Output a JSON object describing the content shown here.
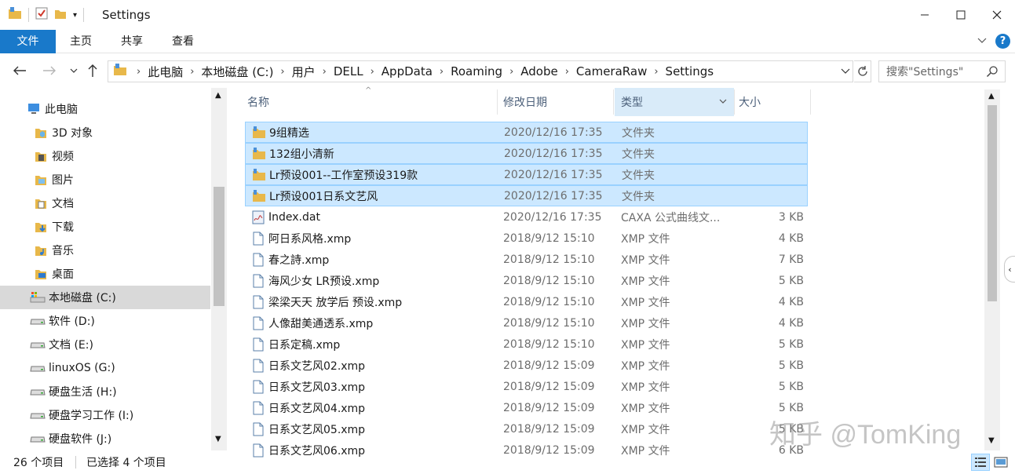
{
  "window": {
    "title": "Settings",
    "controls": {
      "minimize": "minimize-icon",
      "maximize": "maximize-icon",
      "close": "close-icon"
    }
  },
  "ribbon": {
    "tabs": [
      "文件",
      "主页",
      "共享",
      "查看"
    ],
    "accent": "#1979ca",
    "help": "?"
  },
  "address": {
    "breadcrumbs": [
      "此电脑",
      "本地磁盘 (C:)",
      "用户",
      "DELL",
      "AppData",
      "Roaming",
      "Adobe",
      "CameraRaw",
      "Settings"
    ],
    "search_placeholder": "搜索\"Settings\""
  },
  "nav": {
    "items": [
      {
        "label": "此电脑",
        "icon": "computer-icon"
      },
      {
        "label": "3D 对象",
        "icon": "3d-objects-folder-icon"
      },
      {
        "label": "视频",
        "icon": "videos-folder-icon"
      },
      {
        "label": "图片",
        "icon": "pictures-folder-icon"
      },
      {
        "label": "文档",
        "icon": "documents-folder-icon"
      },
      {
        "label": "下载",
        "icon": "downloads-folder-icon"
      },
      {
        "label": "音乐",
        "icon": "music-folder-icon"
      },
      {
        "label": "桌面",
        "icon": "desktop-folder-icon"
      },
      {
        "label": "本地磁盘 (C:)",
        "icon": "system-drive-icon"
      },
      {
        "label": "软件 (D:)",
        "icon": "drive-icon"
      },
      {
        "label": "文档 (E:)",
        "icon": "drive-icon"
      },
      {
        "label": "linuxOS (G:)",
        "icon": "drive-icon"
      },
      {
        "label": "硬盘生活 (H:)",
        "icon": "drive-icon"
      },
      {
        "label": "硬盘学习工作 (I:)",
        "icon": "drive-icon"
      },
      {
        "label": "硬盘软件 (J:)",
        "icon": "drive-icon"
      }
    ],
    "selected_label": "本地磁盘 (C:)"
  },
  "columns": {
    "name": "名称",
    "date": "修改日期",
    "type": "类型",
    "size": "大小"
  },
  "files": [
    {
      "name": "9组精选",
      "date": "2020/12/16 17:35",
      "type": "文件夹",
      "size": "",
      "icon": "folder-icon",
      "selected": true
    },
    {
      "name": "132组小清新",
      "date": "2020/12/16 17:35",
      "type": "文件夹",
      "size": "",
      "icon": "folder-icon",
      "selected": true
    },
    {
      "name": "Lr预设001--工作室预设319款",
      "date": "2020/12/16 17:35",
      "type": "文件夹",
      "size": "",
      "icon": "folder-icon",
      "selected": true
    },
    {
      "name": "Lr预设001日系文艺风",
      "date": "2020/12/16 17:35",
      "type": "文件夹",
      "size": "",
      "icon": "folder-icon",
      "selected": true
    },
    {
      "name": "Index.dat",
      "date": "2020/12/16 17:35",
      "type": "CAXA 公式曲线文...",
      "size": "3 KB",
      "icon": "dat-file-icon",
      "selected": false
    },
    {
      "name": "阿日系风格.xmp",
      "date": "2018/9/12 15:10",
      "type": "XMP 文件",
      "size": "4 KB",
      "icon": "document-icon",
      "selected": false
    },
    {
      "name": "春之詩.xmp",
      "date": "2018/9/12 15:10",
      "type": "XMP 文件",
      "size": "7 KB",
      "icon": "document-icon",
      "selected": false
    },
    {
      "name": "海风少女 LR预设.xmp",
      "date": "2018/9/12 15:10",
      "type": "XMP 文件",
      "size": "5 KB",
      "icon": "document-icon",
      "selected": false
    },
    {
      "name": "梁梁天天 放学后 预设.xmp",
      "date": "2018/9/12 15:10",
      "type": "XMP 文件",
      "size": "4 KB",
      "icon": "document-icon",
      "selected": false
    },
    {
      "name": "人像甜美通透系.xmp",
      "date": "2018/9/12 15:10",
      "type": "XMP 文件",
      "size": "4 KB",
      "icon": "document-icon",
      "selected": false
    },
    {
      "name": "日系定稿.xmp",
      "date": "2018/9/12 15:10",
      "type": "XMP 文件",
      "size": "5 KB",
      "icon": "document-icon",
      "selected": false
    },
    {
      "name": "日系文艺风02.xmp",
      "date": "2018/9/12 15:09",
      "type": "XMP 文件",
      "size": "5 KB",
      "icon": "document-icon",
      "selected": false
    },
    {
      "name": "日系文艺风03.xmp",
      "date": "2018/9/12 15:09",
      "type": "XMP 文件",
      "size": "5 KB",
      "icon": "document-icon",
      "selected": false
    },
    {
      "name": "日系文艺风04.xmp",
      "date": "2018/9/12 15:09",
      "type": "XMP 文件",
      "size": "5 KB",
      "icon": "document-icon",
      "selected": false
    },
    {
      "name": "日系文艺风05.xmp",
      "date": "2018/9/12 15:09",
      "type": "XMP 文件",
      "size": "5 KB",
      "icon": "document-icon",
      "selected": false
    },
    {
      "name": "日系文艺风06.xmp",
      "date": "2018/9/12 15:09",
      "type": "XMP 文件",
      "size": "6 KB",
      "icon": "document-icon",
      "selected": false
    }
  ],
  "status": {
    "item_count": "26 个项目",
    "selection": "已选择 4 个项目"
  },
  "watermark": "知乎 @TomKing",
  "colors": {
    "selection_bg": "#cce8ff",
    "selection_border": "#99d1ff",
    "folder": "#e8b84a"
  }
}
